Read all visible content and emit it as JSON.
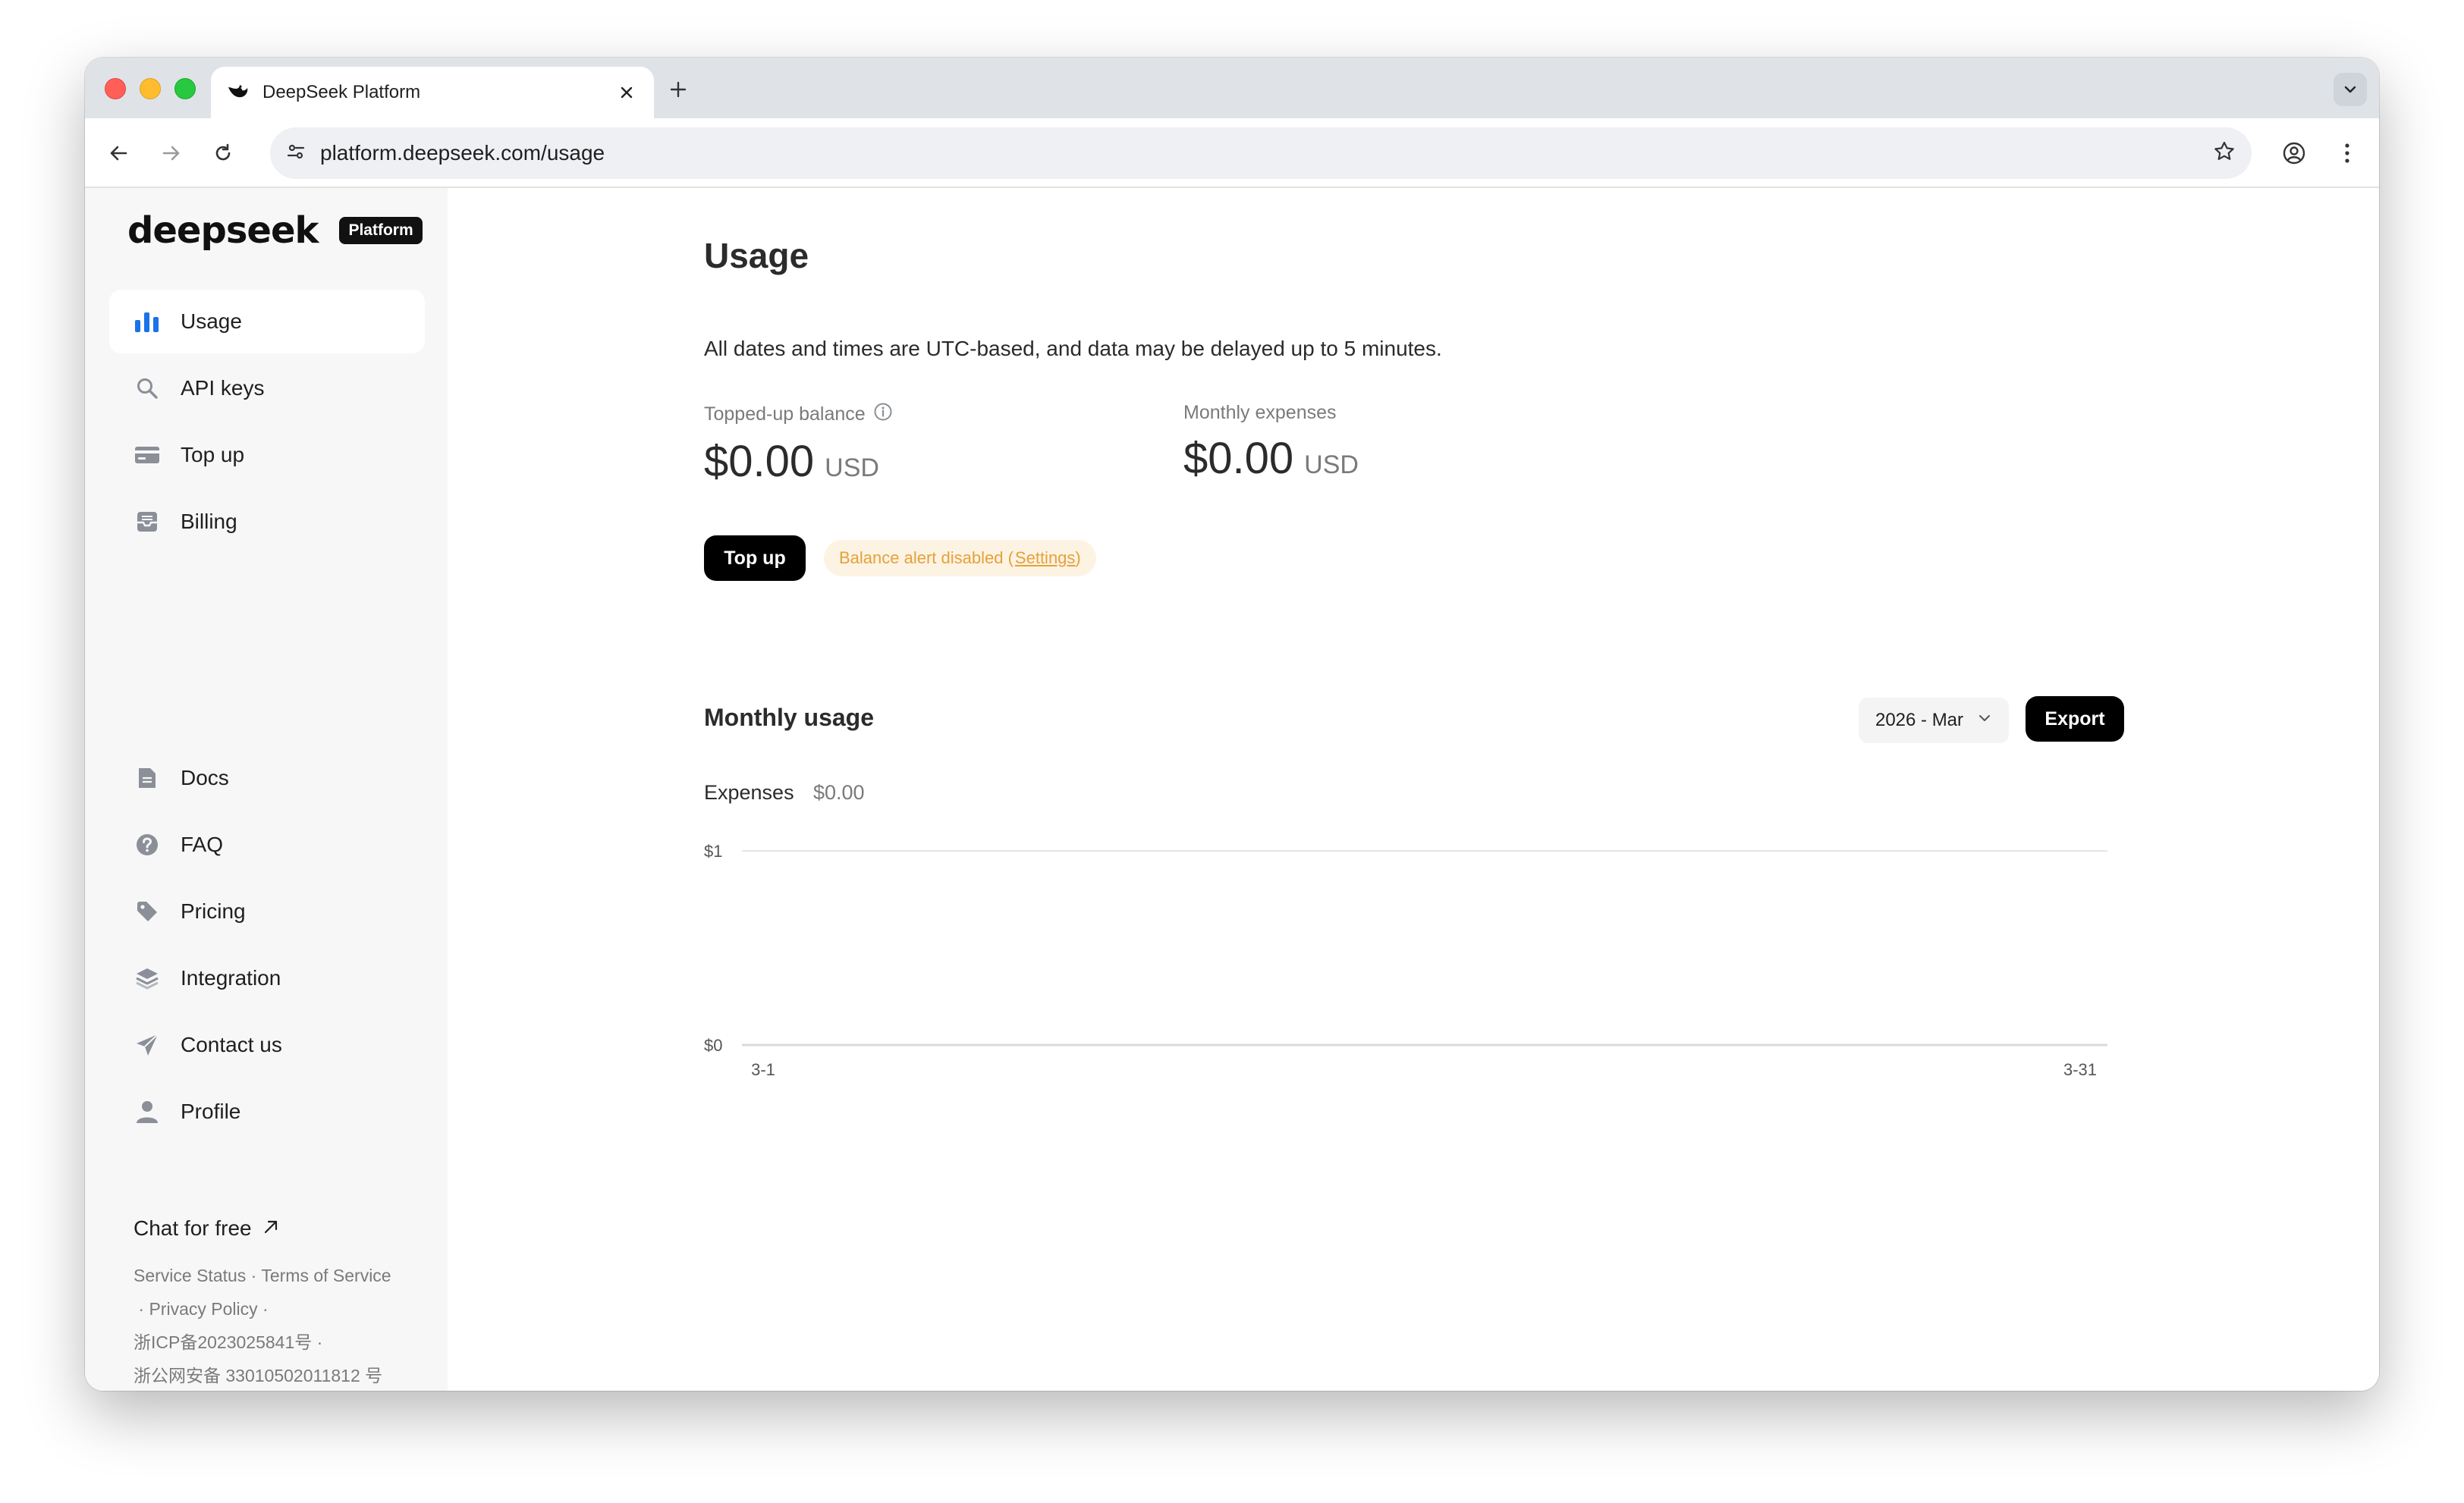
{
  "browser": {
    "tab_title": "DeepSeek Platform",
    "url_host": "platform.deepseek.com",
    "url_path": "/usage"
  },
  "sidebar": {
    "logo_text": "deepseek",
    "logo_badge": "Platform",
    "nav_top": [
      {
        "label": "Usage",
        "icon": "bar-chart-icon",
        "active": true
      },
      {
        "label": "API keys",
        "icon": "search-key-icon"
      },
      {
        "label": "Top up",
        "icon": "card-icon"
      },
      {
        "label": "Billing",
        "icon": "inbox-icon"
      }
    ],
    "nav_bottom": [
      {
        "label": "Docs",
        "icon": "document-icon"
      },
      {
        "label": "FAQ",
        "icon": "question-icon"
      },
      {
        "label": "Pricing",
        "icon": "tag-icon"
      },
      {
        "label": "Integration",
        "icon": "layers-icon"
      },
      {
        "label": "Contact us",
        "icon": "send-icon"
      },
      {
        "label": "Profile",
        "icon": "user-icon"
      }
    ],
    "chat_free": "Chat for free",
    "footer": {
      "service_status": "Service Status",
      "terms": "Terms of Service",
      "privacy": "Privacy Policy",
      "icp": "浙ICP备2023025841号",
      "police": "浙公网安备 33010502011812 号"
    }
  },
  "main": {
    "title": "Usage",
    "notice": "All dates and times are UTC-based, and data may be delayed up to 5 minutes.",
    "balance": {
      "label": "Topped-up balance",
      "amount": "$0.00",
      "unit": "USD"
    },
    "expenses": {
      "label": "Monthly expenses",
      "amount": "$0.00",
      "unit": "USD"
    },
    "topup_button": "Top up",
    "alert_text": "Balance alert disabled (",
    "alert_link": "Settings",
    "alert_close": ")",
    "monthly_title": "Monthly usage",
    "month_select": "2026 - Mar",
    "export_button": "Export",
    "expenses_label": "Expenses",
    "expenses_total": "$0.00"
  },
  "chart_data": {
    "type": "line",
    "x": [
      "3-1",
      "3-31"
    ],
    "series": [
      {
        "values": [
          0,
          0
        ]
      }
    ],
    "ylim": [
      0,
      1
    ],
    "ytick_labels": [
      "$0",
      "$1"
    ],
    "xtick_labels": [
      "3-1",
      "3-31"
    ],
    "grid": true,
    "colors": {
      "grid": "#e5e5e5",
      "axis": "#d9d9de"
    }
  }
}
